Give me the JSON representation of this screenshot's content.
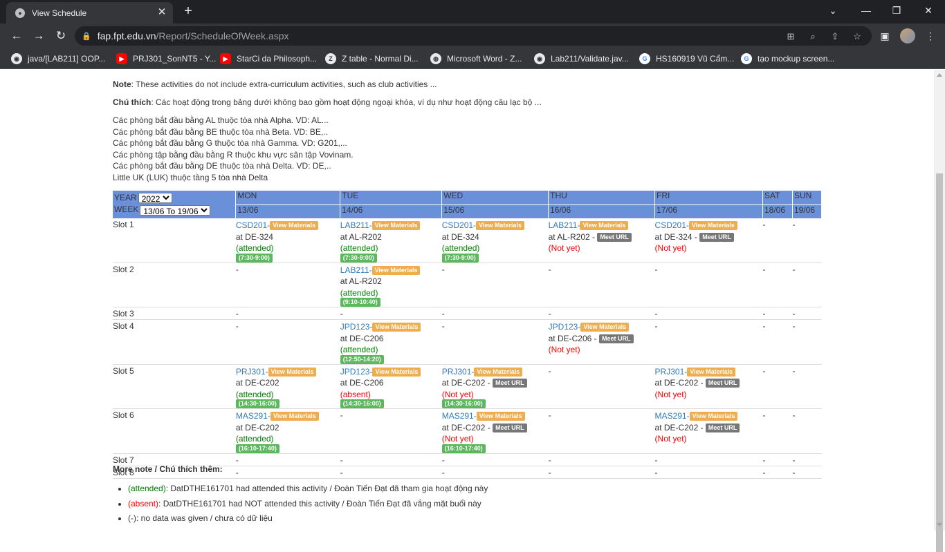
{
  "browser": {
    "tab_title": "View Schedule",
    "url_host": "fap.fpt.edu.vn",
    "url_path": "/Report/ScheduleOfWeek.aspx",
    "bookmarks": [
      {
        "label": "java/[LAB211] OOP...",
        "icon": "github-icon"
      },
      {
        "label": "PRJ301_SonNT5 - Y...",
        "icon": "youtube-icon"
      },
      {
        "label": "StarCi da Philosoph...",
        "icon": "youtube-icon"
      },
      {
        "label": "Z table - Normal Di...",
        "icon": "z-icon"
      },
      {
        "label": "Microsoft Word - Z...",
        "icon": "globe-icon"
      },
      {
        "label": "Lab211/Validate.jav...",
        "icon": "github-icon"
      },
      {
        "label": "HS160919 Vũ Cẩm...",
        "icon": "google-icon"
      },
      {
        "label": "tạo mockup screen...",
        "icon": "google-icon"
      }
    ]
  },
  "notes": {
    "note_label": "Note",
    "note_text": ": These activities do not include extra-curriculum activities, such as club activities ...",
    "chuthich_label": "Chú thích",
    "chuthich_text": ": Các hoạt động trong bảng dưới không bao gồm hoạt động ngoại khóa, ví dụ như hoạt động câu lạc bộ ...",
    "rooms": [
      "Các phòng bắt đầu bằng AL thuộc tòa nhà Alpha. VD: AL...",
      "Các phòng bắt đầu bằng BE thuộc tòa nhà Beta. VD: BE,..",
      "Các phòng bắt đầu bằng G thuộc tòa nhà Gamma. VD: G201,...",
      "Các phòng tập bằng đầu bằng R thuộc khu vực sân tập Vovinam.",
      "Các phòng bắt đầu bằng DE thuộc tòa nhà Delta. VD: DE,..",
      "Little UK (LUK) thuộc tầng 5 tòa nhà Delta"
    ]
  },
  "schedule": {
    "year_label": "YEAR",
    "year_value": "2022",
    "week_label": "WEEK",
    "week_value": "13/06 To 19/06",
    "days": [
      "MON",
      "TUE",
      "WED",
      "THU",
      "FRI",
      "SAT",
      "SUN"
    ],
    "dates": [
      "13/06",
      "14/06",
      "15/06",
      "16/06",
      "17/06",
      "18/06",
      "19/06"
    ],
    "view_materials": "View Materials",
    "meet_url": "Meet URL",
    "slots": [
      {
        "label": "Slot 1",
        "cells": [
          {
            "code": "CSD201-",
            "room": "at DE-324",
            "status": "(attended)",
            "st": "att",
            "time": "(7:30-9:00)"
          },
          {
            "code": "LAB211-",
            "room": "at AL-R202",
            "status": "(attended)",
            "st": "att",
            "time": "(7:30-9:00)"
          },
          {
            "code": "CSD201-",
            "room": "at DE-324",
            "status": "(attended)",
            "st": "att",
            "time": "(7:30-9:00)"
          },
          {
            "code": "LAB211-",
            "room": "at AL-R202 - ",
            "meet": true,
            "status": "(Not yet)",
            "st": "ny"
          },
          {
            "code": "CSD201-",
            "room": "at DE-324 - ",
            "meet": true,
            "status": "(Not yet)",
            "st": "ny"
          },
          {
            "dash": "-"
          },
          {
            "dash": "-"
          }
        ]
      },
      {
        "label": "Slot 2",
        "cells": [
          {
            "dash": "-"
          },
          {
            "code": "LAB211-",
            "room": "at AL-R202",
            "status": "(attended)",
            "st": "att",
            "time": "(9:10-10:40)"
          },
          {
            "dash": "-"
          },
          {
            "dash": "-"
          },
          {
            "dash": "-"
          },
          {
            "dash": "-"
          },
          {
            "dash": "-"
          }
        ]
      },
      {
        "label": "Slot 3",
        "cells": [
          {
            "dash": "-"
          },
          {
            "dash": "-"
          },
          {
            "dash": "-"
          },
          {
            "dash": "-"
          },
          {
            "dash": "-"
          },
          {
            "dash": "-"
          },
          {
            "dash": "-"
          }
        ]
      },
      {
        "label": "Slot 4",
        "cells": [
          {
            "dash": "-"
          },
          {
            "code": "JPD123-",
            "room": "at DE-C206",
            "status": "(attended)",
            "st": "att",
            "time": "(12:50-14:20)"
          },
          {
            "dash": "-"
          },
          {
            "code": "JPD123-",
            "room": "at DE-C206 - ",
            "meet": true,
            "status": "(Not yet)",
            "st": "ny"
          },
          {
            "dash": "-"
          },
          {
            "dash": "-"
          },
          {
            "dash": "-"
          }
        ]
      },
      {
        "label": "Slot 5",
        "cells": [
          {
            "code": "PRJ301-",
            "room": "at DE-C202",
            "status": "(attended)",
            "st": "att",
            "time": "(14:30-16:00)"
          },
          {
            "code": "JPD123-",
            "room": "at DE-C206",
            "status": "(absent)",
            "st": "abs",
            "time": "(14:30-16:00)"
          },
          {
            "code": "PRJ301-",
            "room": "at DE-C202 - ",
            "meet": true,
            "status": "(Not yet)",
            "st": "ny",
            "time": "(14:30-16:00)"
          },
          {
            "dash": "-"
          },
          {
            "code": "PRJ301-",
            "room": "at DE-C202 - ",
            "meet": true,
            "status": "(Not yet)",
            "st": "ny"
          },
          {
            "dash": "-"
          },
          {
            "dash": "-"
          }
        ]
      },
      {
        "label": "Slot 6",
        "cells": [
          {
            "code": "MAS291-",
            "room": "at DE-C202",
            "status": "(attended)",
            "st": "att",
            "time": "(16:10-17:40)"
          },
          {
            "dash": "-"
          },
          {
            "code": "MAS291-",
            "room": "at DE-C202 - ",
            "meet": true,
            "status": "(Not yet)",
            "st": "ny",
            "time": "(16:10-17:40)"
          },
          {
            "dash": "-"
          },
          {
            "code": "MAS291-",
            "room": "at DE-C202 - ",
            "meet": true,
            "status": "(Not yet)",
            "st": "ny"
          },
          {
            "dash": "-"
          },
          {
            "dash": "-"
          }
        ]
      },
      {
        "label": "Slot 7",
        "cells": [
          {
            "dash": "-"
          },
          {
            "dash": "-"
          },
          {
            "dash": "-"
          },
          {
            "dash": "-"
          },
          {
            "dash": "-"
          },
          {
            "dash": "-"
          },
          {
            "dash": "-"
          }
        ]
      },
      {
        "label": "Slot 8",
        "cells": [
          {
            "dash": "-"
          },
          {
            "dash": "-"
          },
          {
            "dash": "-"
          },
          {
            "dash": "-"
          },
          {
            "dash": "-"
          },
          {
            "dash": "-"
          },
          {
            "dash": "-"
          }
        ]
      }
    ]
  },
  "more_note": {
    "title": "More note / Chú thích thêm:",
    "items": [
      {
        "key": "(attended)",
        "kind": "att",
        "text": ": DatDTHE161701 had attended this activity / Đoàn Tiến Đạt đã tham gia hoạt động này"
      },
      {
        "key": "(absent)",
        "kind": "abs",
        "text": ": DatDTHE161701 had NOT attended this activity / Đoàn Tiến Đạt đã vắng mặt buổi này"
      },
      {
        "key": "(-)",
        "kind": "plain",
        "text": ": no data was given / chưa có dữ liệu"
      }
    ]
  }
}
